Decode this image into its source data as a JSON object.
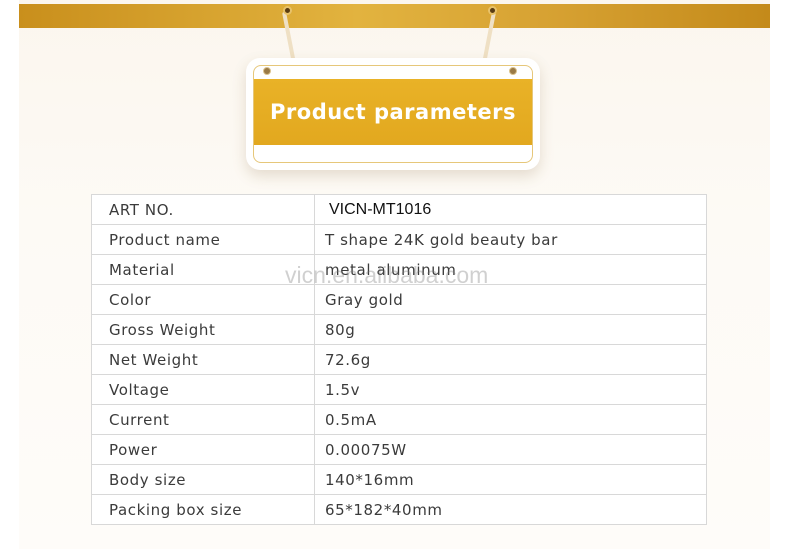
{
  "sign": {
    "title": "Product parameters"
  },
  "watermark": "vicn.en.alibaba.com",
  "parameters": [
    {
      "label": "ART NO.",
      "value": "VICN-MT1016"
    },
    {
      "label": "Product name",
      "value": "T shape 24K gold beauty bar"
    },
    {
      "label": "Material",
      "value": "metal aluminum"
    },
    {
      "label": "Color",
      "value": "Gray gold"
    },
    {
      "label": "Gross Weight",
      "value": "80g"
    },
    {
      "label": "Net Weight",
      "value": "72.6g"
    },
    {
      "label": "Voltage",
      "value": "1.5v"
    },
    {
      "label": "Current",
      "value": "0.5mA"
    },
    {
      "label": "Power",
      "value": "0.00075W"
    },
    {
      "label": "Body size",
      "value": "140*16mm"
    },
    {
      "label": "Packing box size",
      "value": "65*182*40mm"
    }
  ],
  "colors": {
    "accent": "#e2a81f",
    "text": "#3b3b3b",
    "border": "#d8d8d8"
  }
}
